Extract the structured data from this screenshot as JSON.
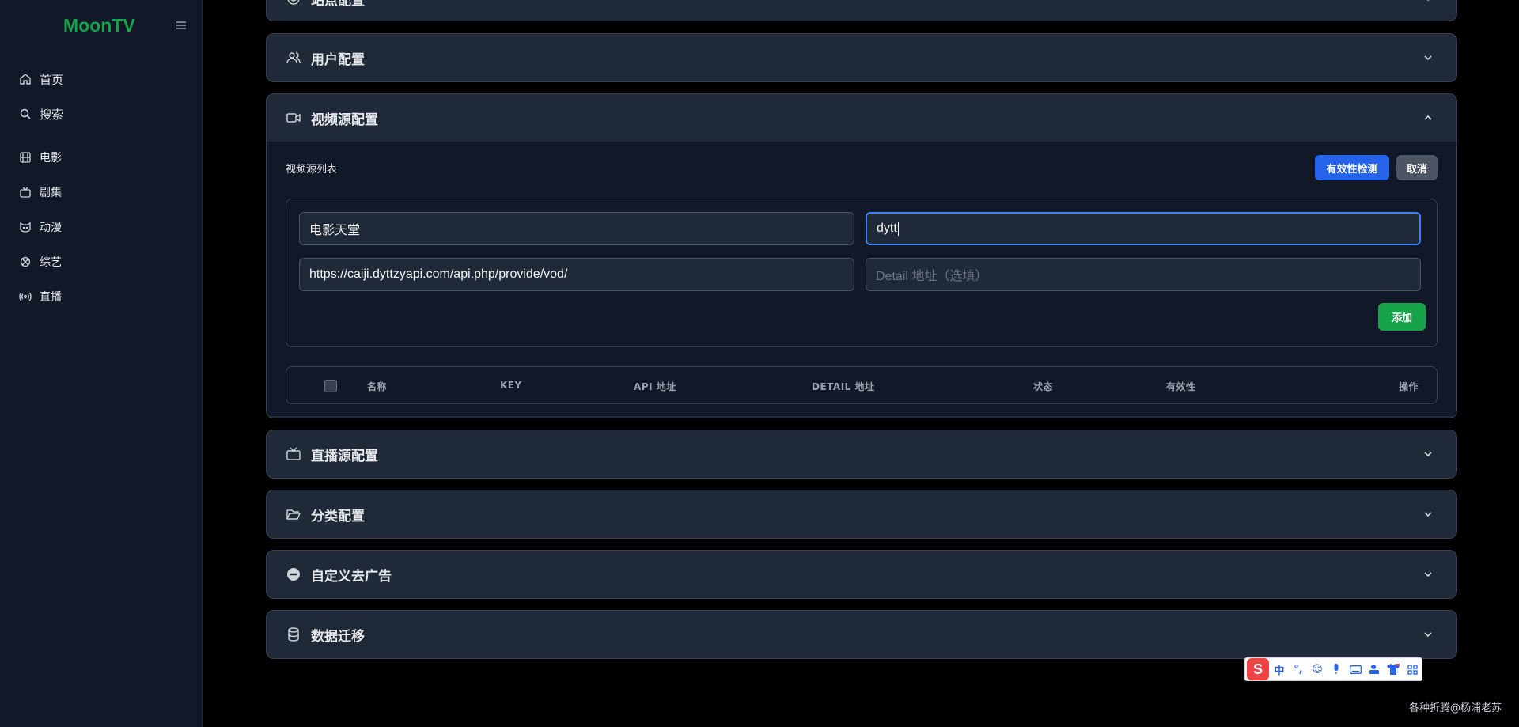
{
  "sidebar": {
    "brand": "MoonTV",
    "items": [
      {
        "label": "首页",
        "icon": "home-icon"
      },
      {
        "label": "搜索",
        "icon": "search-icon"
      },
      {
        "label": "电影",
        "icon": "film-icon"
      },
      {
        "label": "剧集",
        "icon": "tv-icon"
      },
      {
        "label": "动漫",
        "icon": "cat-icon"
      },
      {
        "label": "综艺",
        "icon": "clapper-icon"
      },
      {
        "label": "直播",
        "icon": "broadcast-icon"
      }
    ]
  },
  "panels": {
    "top_partial": "站点配置",
    "user": "用户配置",
    "video": "视频源配置",
    "live": "直播源配置",
    "category": "分类配置",
    "ads": "自定义去广告",
    "migrate": "数据迁移"
  },
  "video_source": {
    "list_title": "视频源列表",
    "check_button": "有效性检测",
    "cancel_button": "取消",
    "name_value": "电影天堂",
    "key_value": "dytt",
    "api_value": "https://caiji.dyttzyapi.com/api.php/provide/vod/",
    "detail_placeholder": "Detail 地址（选填）",
    "add_button": "添加",
    "columns": [
      "名称",
      "KEY",
      "API 地址",
      "DETAIL 地址",
      "状态",
      "有效性",
      "操作"
    ]
  },
  "ime": {
    "logo": "S",
    "lang": "中"
  },
  "watermark": "各种折腾@杨浦老苏",
  "colors": {
    "brand": "#16a34a",
    "primary": "#2563eb",
    "success": "#16a34a"
  }
}
